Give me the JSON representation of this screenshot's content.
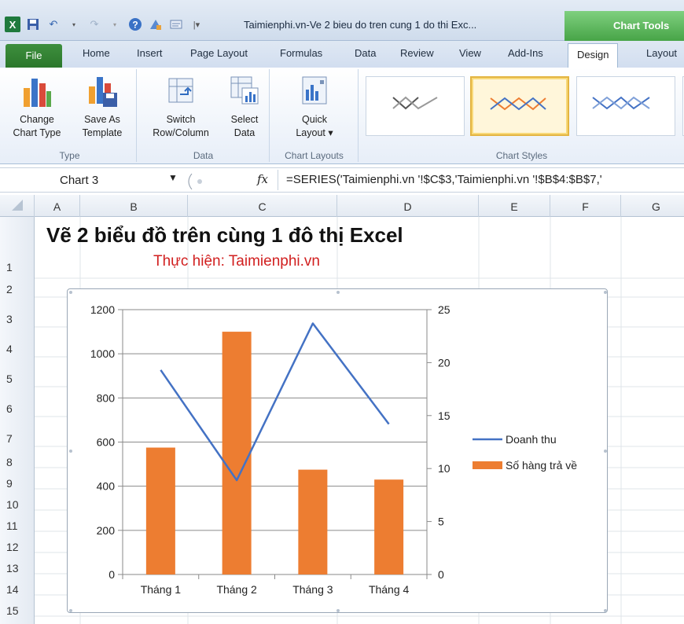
{
  "app": {
    "window_title": "Taimienphi.vn-Ve 2 bieu do tren cung 1 do thi Exc...",
    "context_tab": "Chart Tools"
  },
  "qat": {
    "icons": [
      "excel-logo",
      "save-icon",
      "undo-icon",
      "redo-icon",
      "help-icon",
      "paint-icon",
      "form-icon"
    ]
  },
  "tabs": {
    "file": "File",
    "items": [
      "Home",
      "Insert",
      "Page Layout",
      "Formulas",
      "Data",
      "Review",
      "View",
      "Add-Ins"
    ],
    "active": "Design",
    "after": "Layout"
  },
  "ribbon": {
    "groups": {
      "type": {
        "label": "Type",
        "change_chart_type": "Change\nChart Type",
        "save_as_template": "Save As\nTemplate"
      },
      "data": {
        "label": "Data",
        "switch_row_column": "Switch\nRow/Column",
        "select_data": "Select\nData"
      },
      "chart_layouts": {
        "label": "Chart Layouts",
        "quick_layout": "Quick\nLayout ▾"
      },
      "chart_styles": {
        "label": "Chart Styles"
      }
    }
  },
  "formula_bar": {
    "name_box": "Chart 3",
    "fx": "fx",
    "formula": "=SERIES('Taimienphi.vn '!$C$3,'Taimienphi.vn '!$B$4:$B$7,'"
  },
  "grid": {
    "columns": [
      "A",
      "B",
      "C",
      "D",
      "E",
      "F",
      "G"
    ],
    "rows": [
      "1",
      "2",
      "3",
      "4",
      "5",
      "6",
      "7",
      "8",
      "9",
      "10",
      "11",
      "12",
      "13",
      "14",
      "15"
    ]
  },
  "sheet": {
    "title": "Vẽ 2 biểu đồ trên cùng 1 đô thị Excel",
    "subtitle": "Thực hiện: Taimienphi.vn"
  },
  "chart_data": {
    "type": "bar",
    "categories": [
      "Tháng 1",
      "Tháng 2",
      "Tháng 3",
      "Tháng 4"
    ],
    "series": [
      {
        "name": "Số hàng trả về",
        "kind": "bar",
        "axis": "primary",
        "color": "#ED7D31",
        "values": [
          575,
          1100,
          475,
          430
        ]
      },
      {
        "name": "Doanh thu",
        "kind": "line",
        "axis": "secondary",
        "color": "#4472C4",
        "values": [
          19.3,
          8.9,
          23.7,
          14.2
        ]
      }
    ],
    "y_primary": {
      "ticks": [
        0,
        200,
        400,
        600,
        800,
        1000,
        1200
      ],
      "ylim": [
        0,
        1200
      ]
    },
    "y_secondary": {
      "ticks": [
        0,
        5,
        10,
        15,
        20,
        25
      ],
      "ylim": [
        0,
        25
      ]
    },
    "legend": {
      "position": "right",
      "entries": [
        "Doanh thu",
        "Số hàng trả về"
      ]
    },
    "grid": true
  }
}
